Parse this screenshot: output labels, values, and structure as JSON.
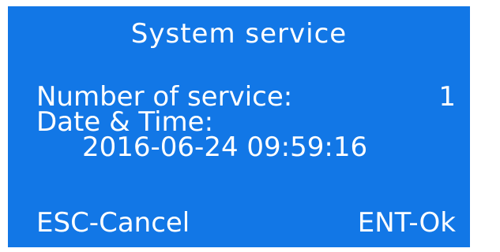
{
  "screen": {
    "title": "System service",
    "fields": {
      "service_count_label": "Number of service:",
      "service_count_value": "1",
      "datetime_label": "Date & Time:",
      "datetime_value": "2016-06-24 09:59:16"
    },
    "softkeys": {
      "left": "ESC-Cancel",
      "right": "ENT-Ok"
    },
    "colors": {
      "background": "#1277e6",
      "text": "#ffffff"
    }
  }
}
